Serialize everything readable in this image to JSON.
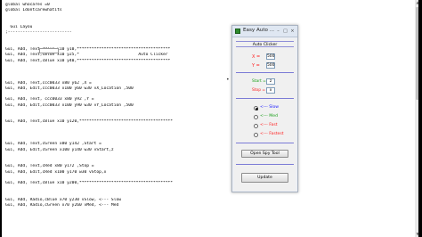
{
  "code": {
    "lines": [
      "global whocares =0",
      "global Idontcarewhatits",
      "",
      "",
      "  Gui Layou",
      ";--------------------------",
      "",
      "",
      "Gui, Add, Text,cBlue x10 y10,**************************************",
      "Gui, Add, Text,cBlue x10 y25,*                        Auto Clicker",
      "Gui, Add, Text,cBlue x10 y40,**************************************",
      "",
      "",
      "",
      "Gui, Add, Text,ccc0033 x80 y62 ,X =",
      "Gui, Add, Edit,ccc0033 x100 y60 w30 vX_Location ,500",
      "",
      "Gui, Add, Text, ccc0033 x80 y92 ,Y =",
      "Gui, Add, Edit,ccc0033 x100 y90 w30 vY_Location ,500",
      "",
      "",
      "Gui, Add, Text,cBlue x10 y120,**************************************",
      "",
      "",
      "",
      "Gui, Add, Text,cGreen x80 y142 ,Start =",
      "Gui, Add, Edit,cGreen x100 y140 w30 vStart,z",
      "",
      "",
      "Gui, Add, Text,cRed x80 y172 ,Stop =",
      "Gui, Add, Edit,cRed x100 y170 w30 vStop,x",
      "",
      "Gui, Add, Text,cBlue x10 y200,**************************************",
      "",
      "",
      "Gui, Add, Radio,cBlue x70 y230 vSlow, <--- Slow",
      "Gui, Add, Radio,cGreen x70 y260 vMed, <--- Med"
    ],
    "inline_label": "Auto Clicker",
    "bullet": "•"
  },
  "scrollbar": {
    "up": "▲",
    "down": "▼"
  },
  "window": {
    "title": "Easy Auto ...",
    "minimize": "–",
    "maximize": "□",
    "close": "×",
    "heading": "Auto Clicker",
    "x_label": "X =",
    "x_value": "500",
    "y_label": "Y =",
    "y_value": "500",
    "start_label": "Start =",
    "start_value": "z",
    "stop_label": "Stop =",
    "stop_value": "x",
    "radios": [
      {
        "label": "<--- Slow",
        "color": "#1a1aff",
        "checked": true
      },
      {
        "label": "<--- Med",
        "color": "#1aa01a",
        "checked": false
      },
      {
        "label": "<--- Fast",
        "color": "#ff2020",
        "checked": false
      },
      {
        "label": "<--- Fastest",
        "color": "#ff2020",
        "checked": false
      }
    ],
    "open_spy_label": "Open Spy Tool",
    "update_label": "Update"
  },
  "colors": {
    "label_red": "#ff2020",
    "label_green": "#1aa01a",
    "separator_blue": "#7b7bd6"
  }
}
